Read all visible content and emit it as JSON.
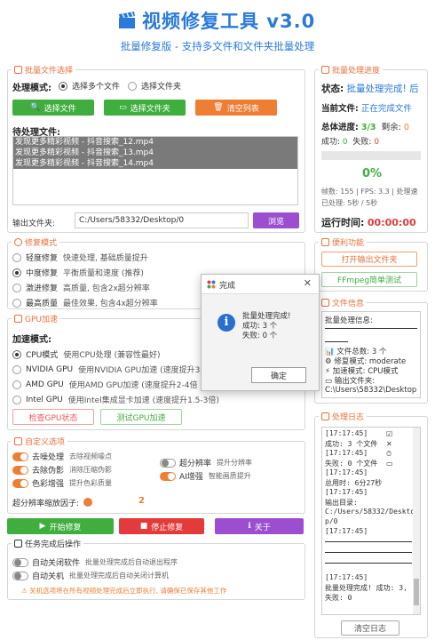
{
  "header": {
    "title": "视频修复工具 v3.0",
    "subtitle": "批量修复版 - 支持多文件和文件夹批量处理"
  },
  "batch": {
    "legend": "批量文件选择",
    "mode_label": "处理模式:",
    "mode_multi": "选择多个文件",
    "mode_folder": "选择文件夹",
    "btn_select_files": "选择文件",
    "btn_select_folder": "选择文件夹",
    "btn_clear": "清空列表",
    "pending_label": "待处理文件:",
    "files": [
      "发现更多精彩视频 - 抖音搜索_12.mp4",
      "发现更多精彩视频 - 抖音搜索_13.mp4",
      "发现更多精彩视频 - 抖音搜索_14.mp4"
    ],
    "output_label": "输出文件夹:",
    "output_value": "C:/Users/58332/Desktop/0",
    "btn_browse": "浏览"
  },
  "repair": {
    "legend": "修复模式",
    "options": [
      {
        "name": "轻度修复",
        "desc": "快速处理, 基础质量提升"
      },
      {
        "name": "中度修复",
        "desc": "平衡质量和速度 (推荐)"
      },
      {
        "name": "激进修复",
        "desc": "高质量, 包含2x超分辨率"
      },
      {
        "name": "最高质量",
        "desc": "最佳效果, 包含4x超分辨率"
      }
    ]
  },
  "gpu": {
    "legend": "GPU加速",
    "mode_label": "加速模式:",
    "options": [
      {
        "name": "CPU模式",
        "desc": "使用CPU处理 (兼容性最好)"
      },
      {
        "name": "NVIDIA GPU",
        "desc": "使用NVIDIA GPU加速 (速度提升3-"
      },
      {
        "name": "AMD GPU",
        "desc": "使用AMD GPU加速 (速度提升2-4倍"
      },
      {
        "name": "Intel GPU",
        "desc": "使用Intel集成显卡加速 (速度提升1.5-3倍)"
      }
    ],
    "btn_check": "检查GPU状态",
    "btn_test": "测试GPU加速"
  },
  "custom": {
    "legend": "自定义选项",
    "deblock": "去噪处理",
    "deblock_desc": "去除视频噪点",
    "deshake": "去除伪影",
    "deshake_desc": "消除压缩伪影",
    "color": "色彩增强",
    "color_desc": "提升色彩质量",
    "superres": "超分辨率",
    "superres_desc": "提升分辨率",
    "ai": "AI增强",
    "ai_desc": "智能画质提升",
    "scale_label": "超分辨率缩放因子:",
    "scale_value": "2"
  },
  "actions": {
    "start": "开始修复",
    "stop": "停止修复",
    "about": "关于"
  },
  "after": {
    "legend": "任务完成后操作",
    "auto_close": "自动关闭软件",
    "auto_close_desc": "批量处理完成后自动退出程序",
    "auto_shutdown": "自动关机",
    "auto_shutdown_desc": "批量处理完成后自动关闭计算机",
    "warning": "关机选项将在所有视频处理完成后立即执行, 请确保已保存其他工作"
  },
  "progress": {
    "legend": "批量处理进度",
    "status_label": "状态:",
    "status_value": "批量处理完成!",
    "status_tail": "后",
    "current_label": "当前文件:",
    "current_value": "正在完成文件",
    "total_label": "总体进度:",
    "total_value": "3/3",
    "remain_label": "剩余:",
    "remain_value": "0",
    "success_label": "成功:",
    "success_value": "0",
    "fail_label": "失败:",
    "fail_value": "0",
    "percent": "0%",
    "bar_fill": 0,
    "frames": "帧数: 155 | FPS: 3.3 | 处理速",
    "done": "已处理: 5秒 / 5秒",
    "runtime_label": "运行时间:",
    "runtime_value": "00:00:00"
  },
  "convenience": {
    "legend": "便利功能",
    "btn_open": "打开输出文件夹",
    "btn_ffmpeg": "FFmpeg简单测试"
  },
  "fileinfo": {
    "legend": "文件信息",
    "heading": "批量处理信息:",
    "count": "文件总数: 3 个",
    "mode": "修复模式: moderate",
    "accel": "加速模式: CPU模式",
    "outdir_label": "输出文件夹:",
    "outdir": "C:\\Users\\58332\\Desktop"
  },
  "log": {
    "legend": "处理日志",
    "lines": [
      "[17:17:45]",
      "成功: 3 个文件",
      "[17:17:45]",
      "失败: 0 个文件",
      "[17:17:45]",
      "总用时: 6分27秒",
      "[17:17:45]",
      "输出目录:",
      "C:/Users/58332/Deskto",
      "p/0",
      "[17:17:45]",
      "[17:17:45]",
      "批量处理完成! 成功: 3,",
      "失败: 0"
    ],
    "btn_clear": "清空日志"
  },
  "dialog": {
    "title": "完成",
    "line1": "批量处理完成!",
    "line2": "成功: 3 个",
    "line3": "失败: 0 个",
    "ok": "确定"
  },
  "colors": {
    "accent_blue": "#2a7ad9",
    "orange": "#ef7e35",
    "green": "#3fae3f",
    "purple": "#9b4fd0",
    "red": "#e33b3b"
  }
}
